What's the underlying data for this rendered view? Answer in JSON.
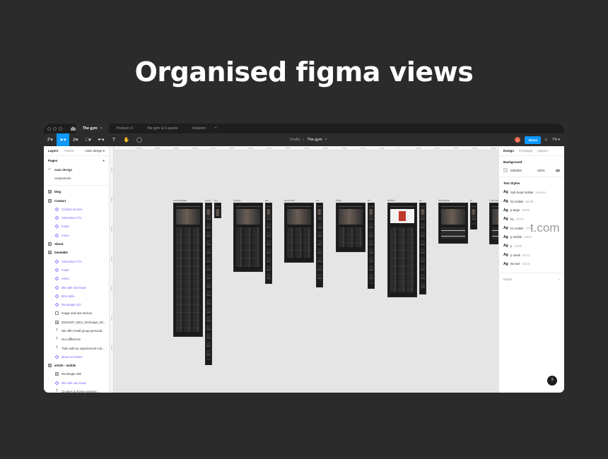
{
  "headline": "Organised figma views",
  "ghost_text": "t.com",
  "tabs": [
    {
      "label": "The gym",
      "active": true
    },
    {
      "label": "Product v1"
    },
    {
      "label": "the gym ui 6 assets"
    },
    {
      "label": "clubworx"
    }
  ],
  "toolbar": {
    "tools": [
      "menu-icon",
      "move-icon",
      "frame-icon",
      "shape-icon",
      "pen-icon",
      "text-icon",
      "hand-icon",
      "comment-icon"
    ],
    "breadcrumb_drafts": "Drafts",
    "breadcrumb_file": "The gym",
    "avatar_initial": "E",
    "share_label": "Share",
    "zoom": "7%"
  },
  "left_panel": {
    "tab_layers": "Layers",
    "tab_assets": "Assets",
    "page_selector": "main design",
    "pages_heading": "Pages",
    "pages": [
      {
        "label": "main design",
        "current": true
      },
      {
        "label": "components"
      }
    ],
    "layers": [
      {
        "label": "blog",
        "kind": "frame",
        "level": 0
      },
      {
        "label": "Contact",
        "kind": "frame",
        "level": 0
      },
      {
        "label": "Contact section",
        "kind": "comp",
        "level": 1
      },
      {
        "label": "Subscribe CTA",
        "kind": "comp",
        "level": 1
      },
      {
        "label": "footer",
        "kind": "comp",
        "level": 1
      },
      {
        "label": "menu",
        "kind": "comp",
        "level": 1
      },
      {
        "label": "About",
        "kind": "frame",
        "level": 0
      },
      {
        "label": "timetable",
        "kind": "frame",
        "level": 0
      },
      {
        "label": "Subscribe CTA",
        "kind": "comp",
        "level": 1
      },
      {
        "label": "footer",
        "kind": "comp",
        "level": 1
      },
      {
        "label": "menu",
        "kind": "comp",
        "level": 1
      },
      {
        "label": "title with sub head",
        "kind": "comp",
        "level": 1
      },
      {
        "label": "time table",
        "kind": "comp",
        "level": 1
      },
      {
        "label": "Rectangle 237",
        "kind": "comp",
        "level": 1
      },
      {
        "label": "Image and text section",
        "kind": "rect",
        "level": 1
      },
      {
        "label": "20211027_BZU_Technique_82...",
        "kind": "img",
        "level": 1
      },
      {
        "label": "We offer small group personal...",
        "kind": "text",
        "level": 1
      },
      {
        "label": "Our difference",
        "kind": "text",
        "level": 1
      },
      {
        "label": "Train with an experienced coa...",
        "kind": "text",
        "level": 1
      },
      {
        "label": "about us button",
        "kind": "comp",
        "level": 1
      },
      {
        "label": "article - mobile",
        "kind": "frame",
        "level": 0
      },
      {
        "label": "Rectangle 238",
        "kind": "img",
        "level": 1
      },
      {
        "label": "title with sub head",
        "kind": "comp",
        "level": 1
      },
      {
        "label": "12 ways at home exercise...",
        "kind": "text",
        "level": 1
      }
    ]
  },
  "canvas": {
    "ruler_top": [
      "-13500",
      "-12000",
      "-11000",
      "-10000",
      "-9000",
      "-8000",
      "-7500",
      "-6000",
      "-5500",
      "-4500",
      "-4000",
      "-3000",
      "-2000",
      "-1000",
      "0",
      "1000",
      "2000",
      "3000",
      "4000",
      "5000"
    ],
    "ruler_left": [
      "4500",
      "5000",
      "5500",
      "6000",
      "6500",
      "7000",
      "7500"
    ],
    "frame_labels": [
      "homepage",
      "hom...",
      "ho...",
      "About",
      "ab...",
      "services",
      "se...",
      "blog",
      "bl...",
      "article",
      "ar...",
      "timetable",
      "ti...",
      "Contact",
      "co..."
    ]
  },
  "right_panel": {
    "tab_design": "Design",
    "tab_prototype": "Prototype",
    "tab_inspect": "Inspect",
    "background_heading": "Background",
    "background_hex": "E5E5E5",
    "background_opacity": "100%",
    "text_styles_heading": "Text Styles",
    "text_styles": [
      {
        "name": "Sub head mobile",
        "spec": "16/Auto"
      },
      {
        "name": "h2 mobile",
        "spec": "60/38"
      },
      {
        "name": "p large",
        "spec": "36/48"
      },
      {
        "name": "h1",
        "spec": "67/70"
      },
      {
        "name": "h1 mobile",
        "spec": "27/40"
      },
      {
        "name": "p mobile",
        "spec": "13/23"
      },
      {
        "name": "p",
        "spec": "16/28"
      },
      {
        "name": "p small",
        "spec": "16/23"
      },
      {
        "name": "list text",
        "spec": "14/18"
      }
    ],
    "export_label": "Export"
  },
  "help_label": "?",
  "colors": {
    "accent": "#0d99ff",
    "component": "#7b61ff",
    "canvas": "#E5E5E5",
    "backdrop": "#2b2b2b"
  }
}
